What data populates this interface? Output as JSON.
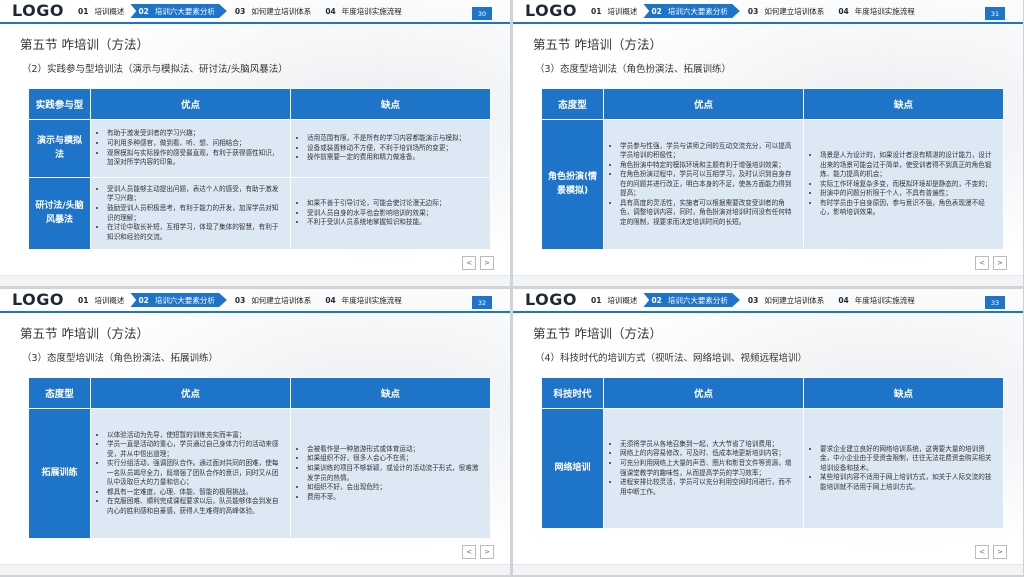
{
  "logo": "LOGO",
  "nav": [
    {
      "num": "01",
      "label": "培训概述"
    },
    {
      "num": "02",
      "label": "培训六大要素分析"
    },
    {
      "num": "03",
      "label": "如何建立培训体系"
    },
    {
      "num": "04",
      "label": "年度培训实施流程"
    }
  ],
  "pager": {
    "prev": "<",
    "next": ">"
  },
  "slides": [
    {
      "page": "30",
      "title": "第五节  咋培训（方法）",
      "subtitle": "（2）实践参与型培训法（演示与模拟法、研讨法/头脑风暴法）",
      "headers": [
        "实践参与型",
        "优点",
        "缺点"
      ],
      "rows": [
        {
          "head": "演示与模拟法",
          "pros": [
            "有助于激发受训者的学习兴趣；",
            "可利用多种感官，做到看、听、想、问相结合；",
            "观察模拟与实际操作的感受最直观，有利于获得感性知识，加深对所学内容的印象。"
          ],
          "cons": [
            "适用范围有限，不是所有的学习内容都能演示与模拟；",
            "设备或装置移动不方便，不利于培训场所的变更；",
            "操作前需要一定的费用和精力做准备。"
          ]
        },
        {
          "head": "研讨法/头脑风暴法",
          "pros": [
            "受训人员能够主动提出问题，表达个人的感受，有助于激发学习兴趣；",
            "鼓励受训人员积极思考，有利于能力的开发，加深学员对知识的理解；",
            "在讨论中取长补短，互相学习，体现了集体的智慧，有利于知识和经验的交流。"
          ],
          "cons": [
            "如果不善于引导讨论，可能会使讨论漫无边际；",
            "受训人员自身的水平也会影响培训的效果；",
            "不利于受训人员系统地掌握知识和技能。"
          ]
        }
      ]
    },
    {
      "page": "31",
      "title": "第五节  咋培训（方法）",
      "subtitle": "（3）态度型培训法（角色扮演法、拓展训练）",
      "headers": [
        "态度型",
        "优点",
        "缺点"
      ],
      "rows": [
        {
          "head": "角色扮演(情景模拟)",
          "pros": [
            "学员参与性强，学员与讲师之间的互动交流充分，可以提高学员培训的积极性；",
            "角色扮演中特定的模拟环境和主题有利于增强培训效果；",
            "在角色扮演过程中，学员可以互相学习，及时认识到自身存在的问题并进行改正，明白本身的不足，使各方面能力得到提高；",
            "具有高度的灵活性，实施者可以根据需要改变受训者的角色，调整培训内容，同时，角色扮演对培训时间没有任何特定的限制，视要求而决定培训时间的长短。"
          ],
          "cons": [
            "场景是人为设计的，如果设计者没有精湛的设计能力，设计出来的场景可能会过于简单，使受训者得不到真正的角色锻炼、能力提高的机会；",
            "实际工作环境复杂多变，而模拟环境却是静态的，不变的；",
            "扮演中的问题分析限于个人，不具有普遍性；",
            "有时学员由于自身原因，参与意识不强，角色表现漫不经心，影响培训效果。"
          ]
        }
      ]
    },
    {
      "page": "32",
      "title": "第五节  咋培训（方法）",
      "subtitle": "（3）态度型培训法（角色扮演法、拓展训练）",
      "headers": [
        "态度型",
        "优点",
        "缺点"
      ],
      "rows": [
        {
          "head": "拓展训练",
          "pros": [
            "以体验活动为先导，使短暂的训练充实而丰富；",
            "学员一直是活动的重心，学员通过自己身体力行的活动来感受，并从中悟出道理；",
            "实行分组活动，强调团队合作。通过面对共同的困难，使每一名队员竭尽全力，既增强了团队合作的意识，同时又从团队中汲取巨大的力量和信心；",
            "都具有一定难度，心理、体能、智能的极限挑战。",
            "在克服困难、顺利完成课程要求以后，队员能够体会到发自内心的胜利感和自豪感，获得人生难得的高峰体验。"
          ],
          "cons": [
            "会被看作是一种旅游形式或体育运动；",
            "如果组织不好，很多人会心不在焉；",
            "如果训练的项目不够新颖，或设计的活动流于形式，很难激发学员的热情。",
            "如组织不好，会出现危险；",
            "费用不菲。"
          ]
        }
      ]
    },
    {
      "page": "33",
      "title": "第五节  咋培训（方法）",
      "subtitle": "（4）科技时代的培训方式（视听法、网络培训、视频远程培训）",
      "headers": [
        "科技时代",
        "优点",
        "缺点"
      ],
      "rows": [
        {
          "head": "网络培训",
          "pros": [
            "无须将学员从各地召集到一起，大大节省了培训费用；",
            "网络上的内容易修改，可及时、低成本地更新培训内容；",
            "可充分利用网络上大量的声音、图片和影音文件等资源，增强课堂教学的趣味性，从而提高学员的学习效率；",
            "进程安排比较灵活，学员可以充分利用空闲时间进行，而不用中断工作。"
          ],
          "cons": [
            "要求企业建立良好的网络培训系统，这需要大量的培训资金，中小企业由于受资金限制，往往无法花费资金购买相关培训设备和技术。",
            "某些培训内容不适用于网上培训方式，如关于人际交流的技能培训就不适用于网上培训方式。"
          ]
        }
      ]
    }
  ]
}
